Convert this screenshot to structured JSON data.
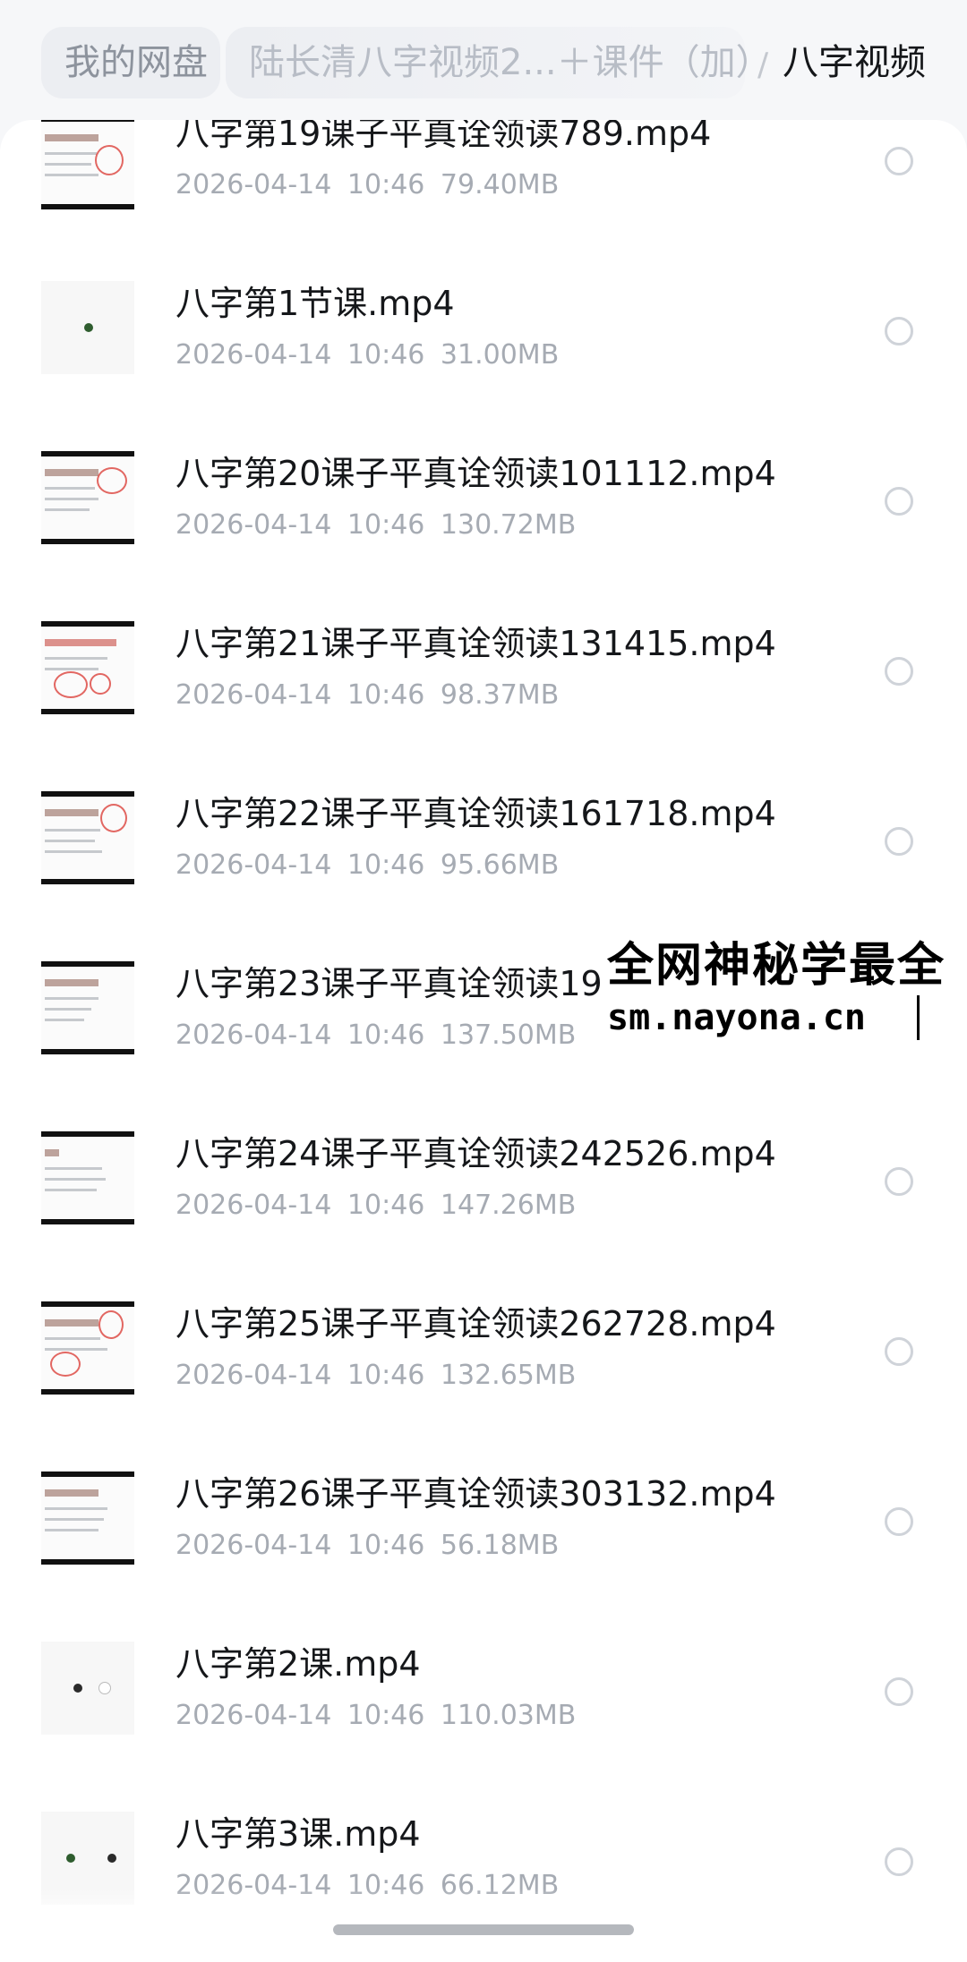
{
  "breadcrumb": {
    "root": "我的网盘",
    "middle": "陆长清八字视频2...＋课件（加）",
    "separator": "/",
    "current": "八字视频"
  },
  "files": [
    {
      "name": "八字第19课子平真诠领读789.mp4",
      "date": "2026-04-14",
      "time": "10:46",
      "size": "79.40MB"
    },
    {
      "name": "八字第1节课.mp4",
      "date": "2026-04-14",
      "time": "10:46",
      "size": "31.00MB"
    },
    {
      "name": "八字第20课子平真诠领读101112.mp4",
      "date": "2026-04-14",
      "time": "10:46",
      "size": "130.72MB"
    },
    {
      "name": "八字第21课子平真诠领读131415.mp4",
      "date": "2026-04-14",
      "time": "10:46",
      "size": "98.37MB"
    },
    {
      "name": "八字第22课子平真诠领读161718.mp4",
      "date": "2026-04-14",
      "time": "10:46",
      "size": "95.66MB"
    },
    {
      "name": "八字第23课子平真诠领读19",
      "date": "2026-04-14",
      "time": "10:46",
      "size": "137.50MB"
    },
    {
      "name": "八字第24课子平真诠领读242526.mp4",
      "date": "2026-04-14",
      "time": "10:46",
      "size": "147.26MB"
    },
    {
      "name": "八字第25课子平真诠领读262728.mp4",
      "date": "2026-04-14",
      "time": "10:46",
      "size": "132.65MB"
    },
    {
      "name": "八字第26课子平真诠领读303132.mp4",
      "date": "2026-04-14",
      "time": "10:46",
      "size": "56.18MB"
    },
    {
      "name": "八字第2课.mp4",
      "date": "2026-04-14",
      "time": "10:46",
      "size": "110.03MB"
    },
    {
      "name": "八字第3课.mp4",
      "date": "2026-04-14",
      "time": "10:46",
      "size": "66.12MB"
    }
  ],
  "watermark": {
    "line1": "全网神秘学最全",
    "line2": "sm.nayona.cn"
  },
  "colors": {
    "background": "#f6f7f9",
    "card": "#ffffff",
    "text_primary": "#15171a",
    "text_secondary": "#a6abb3",
    "radio_border": "#cfd3d9"
  }
}
